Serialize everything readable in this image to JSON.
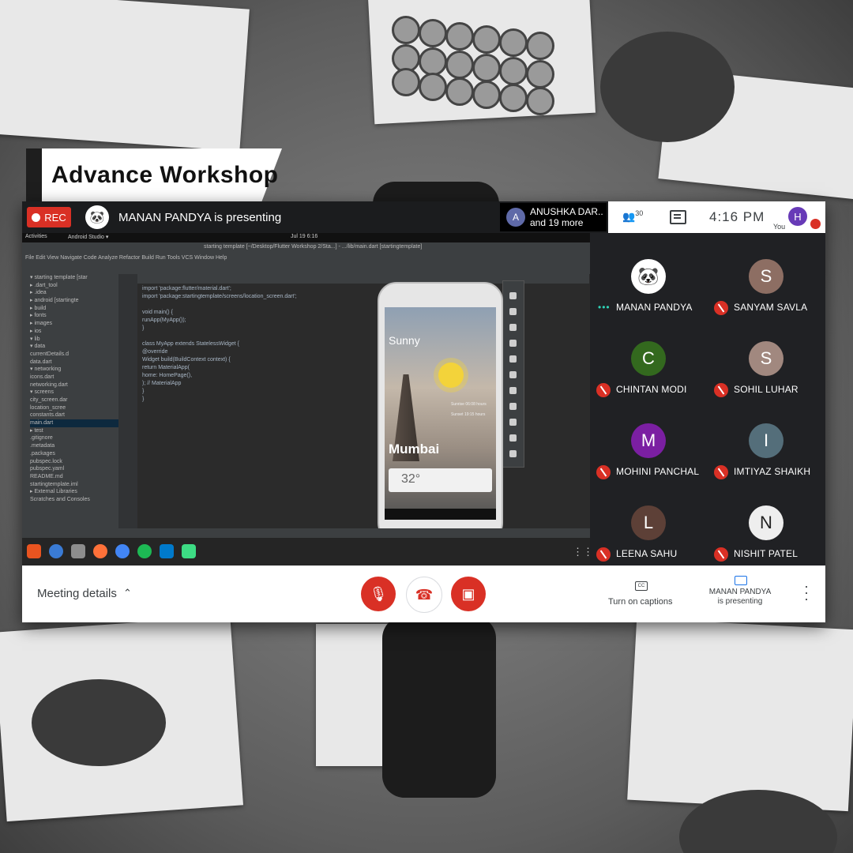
{
  "banner": {
    "title": "Advance Workshop"
  },
  "topbar": {
    "rec_label": "REC",
    "presenting_text": "MANAN PANDYA is presenting",
    "speaker_initial": "A",
    "speaker_line1": "ANUSHKA DAR..",
    "speaker_line2": "and 19 more",
    "people_count": "30",
    "time": "4:16 PM",
    "self_initial": "H",
    "self_label": "You"
  },
  "screen_share": {
    "os_activities": "Activities",
    "os_app": "Android Studio ▾",
    "os_time": "Jul 19  6:16",
    "ide_title": "starting template [~/Desktop/Flutter Workshop 2/Sta...] - .../lib/main.dart [startingtemplate]",
    "ide_menu": "File  Edit  View  Navigate  Code  Analyze  Refactor  Build  Run  Tools  VCS  Window  Help",
    "project_tree": [
      "▾ starting template [star",
      "  ▸ .dart_tool",
      "  ▸ .idea",
      "  ▸ android [startingte",
      "  ▸ build",
      "  ▸ fonts",
      "  ▸ images",
      "  ▸ ios",
      "  ▾ lib",
      "    ▾ data",
      "       currentDetails.d",
      "       data.dart",
      "    ▾ networking",
      "       icons.dart",
      "       networking.dart",
      "    ▾ screens",
      "       city_screen.dar",
      "       location_scree",
      "    constants.dart",
      "    main.dart",
      "  ▸ test",
      "  .gitignore",
      "  .metadata",
      "  .packages",
      "  pubspec.lock",
      "  pubspec.yaml",
      "  README.md",
      "  startingtemplate.iml",
      "▸ External Libraries",
      "  Scratches and Consoles"
    ],
    "code_lines": [
      "import 'package:flutter/material.dart';",
      "import 'package:startingtemplate/screens/location_screen.dart';",
      "",
      "void main() {",
      "  runApp(MyApp());",
      "}",
      "",
      "class MyApp extends StatelessWidget {",
      "  @override",
      "  Widget build(BuildContext context) {",
      "    return MaterialApp(",
      "      home: HomePage(),",
      "    ); // MaterialApp",
      "  }",
      "}"
    ],
    "weather": {
      "condition": "Sunny",
      "city": "Mumbai",
      "temperature": "32°",
      "sunrise": "Sunrise 06:08 hours",
      "sunset": "Sunset 19:15 hours"
    }
  },
  "participants": [
    {
      "name": "MANAN PANDYA",
      "initial": "🐼",
      "avatar_color": "#ffffff",
      "muted": false
    },
    {
      "name": "SANYAM SAVLA",
      "initial": "S",
      "avatar_color": "#8d6e63",
      "muted": true
    },
    {
      "name": "CHINTAN MODI",
      "initial": "C",
      "avatar_color": "#33691e",
      "muted": true
    },
    {
      "name": "SOHIL LUHAR",
      "initial": "S",
      "avatar_color": "#a1887f",
      "muted": true
    },
    {
      "name": "MOHINI PANCHAL",
      "initial": "M",
      "avatar_color": "#7b1fa2",
      "muted": true
    },
    {
      "name": "IMTIYAZ SHAIKH",
      "initial": "I",
      "avatar_color": "#546e7a",
      "muted": true
    },
    {
      "name": "LEENA SAHU",
      "initial": "L",
      "avatar_color": "#5d4037",
      "muted": true
    },
    {
      "name": "NISHIT PATEL",
      "initial": "N",
      "avatar_color": "#eeeeee",
      "muted": true
    }
  ],
  "bottom": {
    "meeting_details": "Meeting details",
    "captions": "Turn on captions",
    "presenting_line1": "MANAN PANDYA",
    "presenting_line2": "is presenting"
  },
  "colors": {
    "accent_red": "#d93025",
    "meet_dark": "#202124",
    "speaking": "#2ed3b7"
  }
}
